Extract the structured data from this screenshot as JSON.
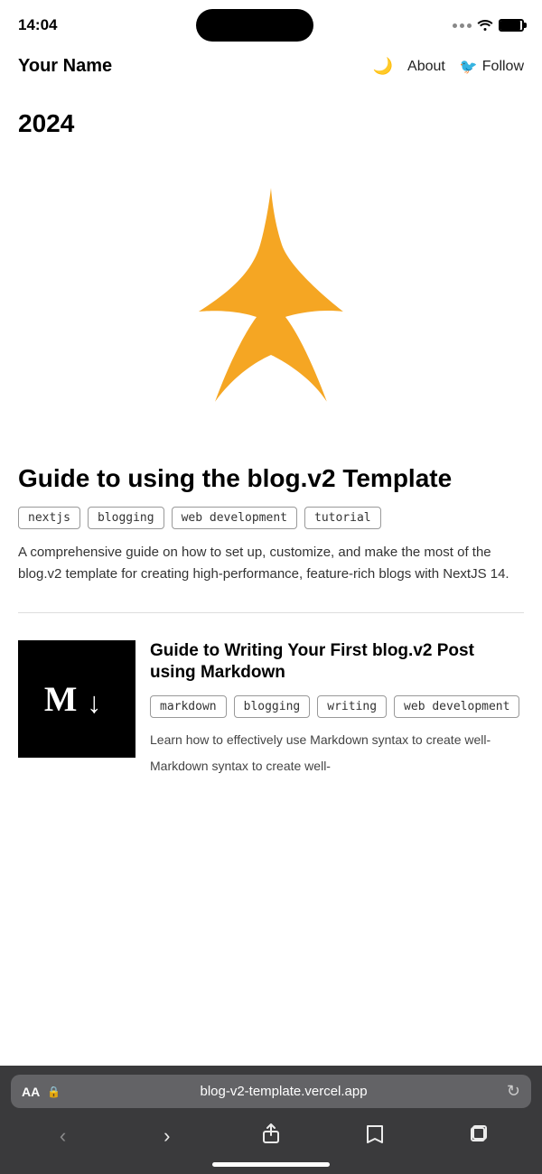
{
  "statusBar": {
    "time": "14:04",
    "wifiIcon": "wifi",
    "batteryIcon": "battery"
  },
  "nav": {
    "logo": "Your Name",
    "moonIcon": "🌙",
    "aboutLabel": "About",
    "twitterIcon": "🐦",
    "followLabel": "Follow"
  },
  "main": {
    "yearLabel": "2024",
    "featuredPost": {
      "title": "Guide to using the blog.v2 Template",
      "tags": [
        "nextjs",
        "blogging",
        "web development",
        "tutorial"
      ],
      "description": "A comprehensive guide on how to set up, customize, and make the most of the blog.v2 template for creating high-performance, feature-rich blogs with NextJS 14."
    },
    "secondPost": {
      "title": "Guide to Writing Your First blog.v2 Post using Markdown",
      "tags": [
        "markdown",
        "blogging",
        "writing",
        "web development"
      ],
      "descriptionPartial": "Learn how to effectively use Markdown syntax to create well-"
    }
  },
  "browserBar": {
    "aaLabel": "AA",
    "lockIcon": "🔒",
    "urlText": "blog-v2-template.vercel.app",
    "reloadIcon": "↻"
  }
}
